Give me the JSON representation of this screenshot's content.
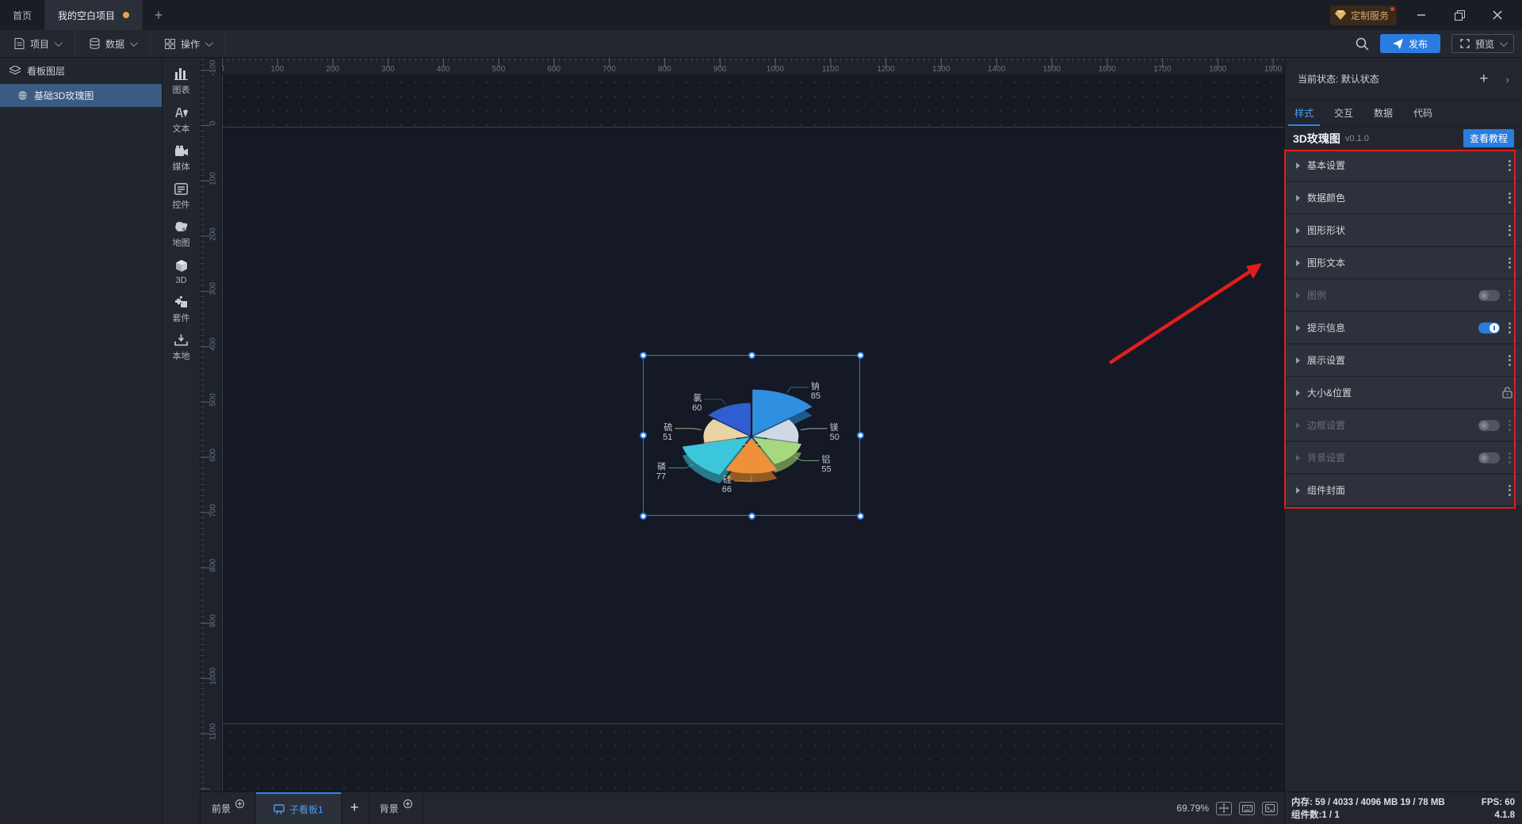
{
  "titlebar": {
    "tab_home": "首页",
    "tab_project": "我的空白项目",
    "new_tab_plus": "+",
    "custom_service": "定制服务"
  },
  "menubar": {
    "items": [
      {
        "label": "项目",
        "icon": "document-icon"
      },
      {
        "label": "数据",
        "icon": "database-icon"
      },
      {
        "label": "操作",
        "icon": "grid-icon"
      }
    ],
    "publish_label": "发布",
    "preview_label": "预览"
  },
  "left_panel": {
    "header": "看板图层",
    "layers": [
      {
        "label": "基础3D玫瑰图",
        "icon": "sphere-icon",
        "selected": true
      }
    ]
  },
  "toolbox": {
    "items": [
      {
        "label": "图表",
        "icon": "bar-chart-icon"
      },
      {
        "label": "文本",
        "icon": "text-icon"
      },
      {
        "label": "媒体",
        "icon": "media-icon"
      },
      {
        "label": "控件",
        "icon": "widget-icon"
      },
      {
        "label": "地图",
        "icon": "map-icon"
      },
      {
        "label": "3D",
        "icon": "cube-icon"
      },
      {
        "label": "套件",
        "icon": "kit-icon"
      },
      {
        "label": "本地",
        "icon": "local-icon"
      }
    ]
  },
  "right_panel": {
    "state_label": "当前状态:",
    "state_value": "默认状态",
    "tabs": [
      {
        "label": "样式",
        "active": true
      },
      {
        "label": "交互",
        "active": false
      },
      {
        "label": "数据",
        "active": false
      },
      {
        "label": "代码",
        "active": false
      }
    ],
    "component_name": "3D玫瑰图",
    "component_version": "v0.1.0",
    "tutorial_button": "查看教程",
    "sections": [
      {
        "label": "基本设置",
        "control": "menu",
        "disabled": false
      },
      {
        "label": "数据颜色",
        "control": "menu",
        "disabled": false
      },
      {
        "label": "图形形状",
        "control": "menu",
        "disabled": false
      },
      {
        "label": "图形文本",
        "control": "menu",
        "disabled": false
      },
      {
        "label": "图例",
        "control": "toggle-off-menu",
        "disabled": true
      },
      {
        "label": "提示信息",
        "control": "toggle-on-menu",
        "disabled": false
      },
      {
        "label": "展示设置",
        "control": "menu",
        "disabled": false
      },
      {
        "label": "大小&位置",
        "control": "lock",
        "disabled": false
      },
      {
        "label": "边框设置",
        "control": "toggle-off-menu",
        "disabled": true
      },
      {
        "label": "背景设置",
        "control": "toggle-off-menu",
        "disabled": true
      },
      {
        "label": "组件封面",
        "control": "menu",
        "disabled": false
      }
    ]
  },
  "bottom_bar": {
    "foreground_label": "前景",
    "subboard_tab": "子看板1",
    "add_tab_plus": "+",
    "background_label": "背景",
    "zoom_level": "69.79%"
  },
  "status_bar": {
    "memory_label": "内存:",
    "memory_value": "59 / 4033 / 4096 MB 19 / 78 MB",
    "fps_label": "FPS:",
    "fps_value": "60",
    "components_label": "组件数:",
    "components_value": "1 / 1",
    "app_version": "4.1.8"
  },
  "chart_data": {
    "type": "pie",
    "variant": "3d-rose",
    "title": "",
    "legend_visible": false,
    "labels_visible": true,
    "data": [
      {
        "name": "钠",
        "value": 85,
        "color": "#2f8fe0"
      },
      {
        "name": "镁",
        "value": 50,
        "color": "#cdd9e5"
      },
      {
        "name": "铝",
        "value": 55,
        "color": "#a6d97f"
      },
      {
        "name": "硅",
        "value": 66,
        "color": "#ef9138"
      },
      {
        "name": "磷",
        "value": 77,
        "color": "#3bc6dc"
      },
      {
        "name": "硫",
        "value": 51,
        "color": "#e8d4a4"
      },
      {
        "name": "氯",
        "value": 60,
        "color": "#2e5ed2"
      }
    ]
  },
  "annotations": {
    "accent_red": "#e11d1d",
    "select_blue": "#2b7ce0"
  }
}
